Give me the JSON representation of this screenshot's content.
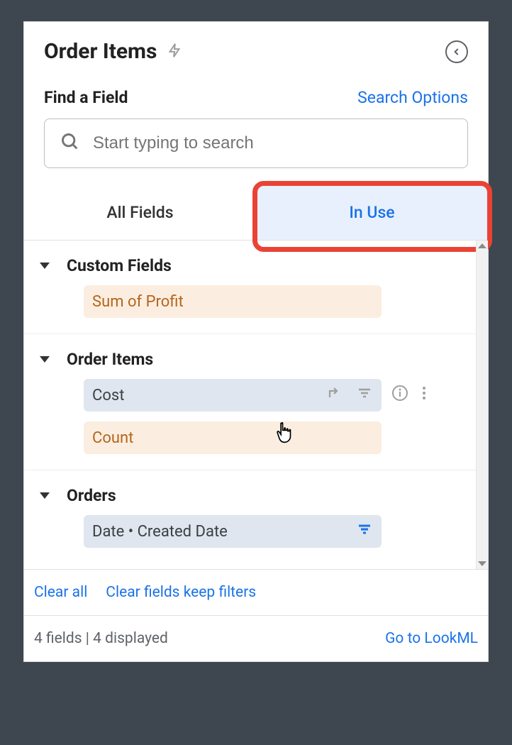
{
  "header": {
    "title": "Order Items"
  },
  "search": {
    "find_label": "Find a Field",
    "options_label": "Search Options",
    "placeholder": "Start typing to search"
  },
  "tabs": {
    "all": "All Fields",
    "in_use": "In Use"
  },
  "groups": [
    {
      "name": "Custom Fields",
      "fields": [
        {
          "label": "Sum of Profit",
          "kind": "measure"
        }
      ]
    },
    {
      "name": "Order Items",
      "fields": [
        {
          "label": "Cost",
          "kind": "dimension",
          "hovered": true
        },
        {
          "label": "Count",
          "kind": "measure"
        }
      ]
    },
    {
      "name": "Orders",
      "fields": [
        {
          "label": "Date • Created Date",
          "kind": "dimension",
          "filtered": true
        }
      ]
    }
  ],
  "footer": {
    "clear_all": "Clear all",
    "clear_keep": "Clear fields keep filters",
    "status": "4 fields | 4 displayed",
    "go_lookml": "Go to LookML"
  }
}
